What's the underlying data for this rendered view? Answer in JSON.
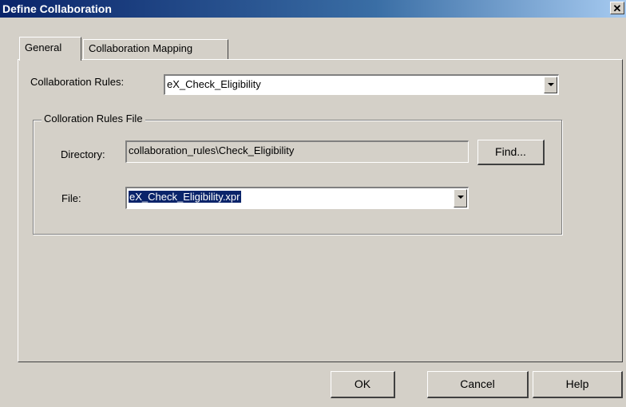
{
  "window": {
    "title": "Define Collaboration",
    "close_glyph": "✕"
  },
  "tabs": [
    {
      "label": "General",
      "active": true
    },
    {
      "label": "Collaboration Mapping",
      "active": false
    }
  ],
  "general": {
    "rules_label": "Collaboration Rules:",
    "rules_value": "eX_Check_Eligibility",
    "group_title": "Colloration Rules File",
    "directory_label": "Directory:",
    "directory_value": "collaboration_rules\\Check_Eligibility",
    "find_label": "Find...",
    "file_label": "File:",
    "file_value": "eX_Check_Eligibility.xpr"
  },
  "footer": {
    "ok_label": "OK",
    "cancel_label": "Cancel",
    "help_label": "Help"
  },
  "colors": {
    "face": "#d4d0c8",
    "title_start": "#0a246a",
    "title_end": "#a6caf0",
    "selection": "#0a246a"
  }
}
